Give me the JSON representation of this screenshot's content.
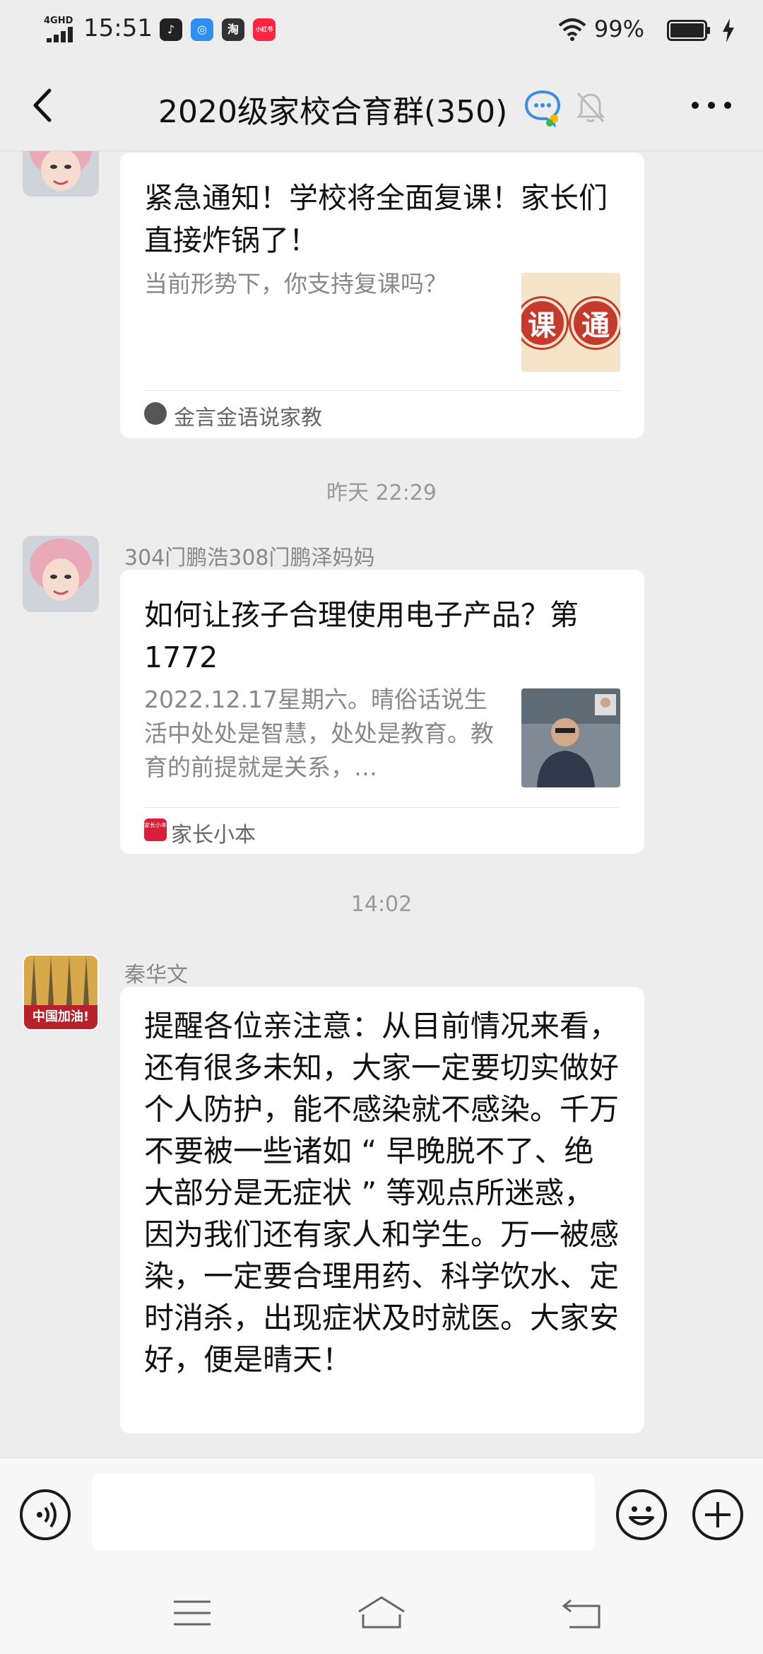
{
  "status_bar": {
    "network": "4GHD",
    "time": "15:51",
    "apps": [
      {
        "name": "tiktok-icon",
        "glyph": "♪",
        "color": "#222222"
      },
      {
        "name": "browser-app-icon",
        "glyph": "◎",
        "color": "#2f8ff0"
      },
      {
        "name": "taobao-icon",
        "glyph": "淘",
        "color": "#333333"
      },
      {
        "name": "xiaohongshu-icon",
        "glyph": "小红书",
        "color": "#ff2442"
      }
    ],
    "battery": "99%"
  },
  "header": {
    "title": "2020级家校合育群(350)"
  },
  "messages": {
    "card1": {
      "title": "紧急通知！学校将全面复课！家长们直接炸锅了！",
      "desc": "当前形势下，你支持复课吗？",
      "thumb_text": [
        "课",
        "通"
      ],
      "source": "金言金语说家教"
    },
    "time1": "昨天 22:29",
    "card2": {
      "sender": "304门鹏浩308门鹏泽妈妈",
      "title": "如何让孩子合理使用电子产品？第1772",
      "desc": "2022.12.17星期六。晴俗话说生活中处处是智慧，处处是教育。教育的前提就是关系，…",
      "source_icon_text": "家长小本",
      "source": "家长小本"
    },
    "time2": "14:02",
    "msg3": {
      "sender": "秦华文",
      "avatar_text": "中国加油!",
      "text": "提醒各位亲注意：从目前情况来看，还有很多未知，大家一定要切实做好个人防护，能不感染就不感染。千万不要被一些诸如 “ 早晚脱不了、绝大部分是无症状 ” 等观点所迷惑，因为我们还有家人和学生。万一被感染，一定要合理用药、科学饮水、定时消杀，出现症状及时就医。大家安好，便是晴天！"
    }
  },
  "input_bar": {
    "placeholder": ""
  }
}
